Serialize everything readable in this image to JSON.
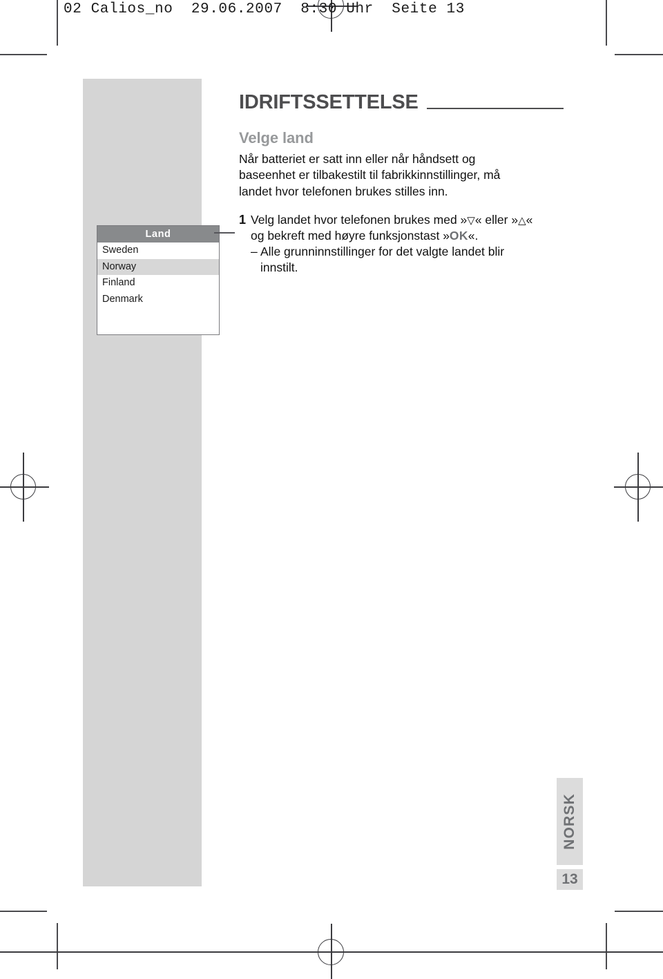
{
  "file_header": "02 Calios_no  29.06.2007  8:30 Uhr  Seite 13",
  "chapter": {
    "title": "IDRIFTSSETTELSE"
  },
  "section": {
    "title": "Velge land",
    "intro_line1": "Når batteriet er satt inn eller når håndsett og",
    "intro_line2": "baseenhet er tilbakestilt til fabrikkinnstillinger, må",
    "intro_line3": "landet hvor telefonen brukes stilles inn."
  },
  "steps": [
    {
      "number": "1",
      "text_line1_a": "Velg landet hvor telefonen brukes med »",
      "down_arrow": "▽",
      "text_line1_b": "« eller »",
      "up_arrow": "△",
      "text_line1_c": "«",
      "text_line2_a": "og bekreft med høyre funksjonstast »",
      "ok_label": "OK",
      "text_line2_b": "«.",
      "substeps": [
        {
          "dash": "–",
          "text": "Alle grunninnstillinger for det valgte landet blir",
          "tail": "innstilt."
        }
      ]
    }
  ],
  "display": {
    "title": "Land",
    "rows": [
      {
        "label": "Sweden",
        "selected": false
      },
      {
        "label": "Norway",
        "selected": true
      },
      {
        "label": "Finland",
        "selected": false
      },
      {
        "label": "Denmark",
        "selected": false
      }
    ]
  },
  "footer": {
    "language_tab": "NORSK",
    "page_number": "13"
  },
  "colors": {
    "band_grey": "#d5d5d5",
    "title_grey": "#4d4d4f",
    "section_grey": "#97999b",
    "display_titlebar": "#888a8c",
    "display_selected_row": "#d7d7d7",
    "tab_grey": "#dcdcdc",
    "tab_text": "#6f7174",
    "crop_mark": "#4a4a4e"
  }
}
